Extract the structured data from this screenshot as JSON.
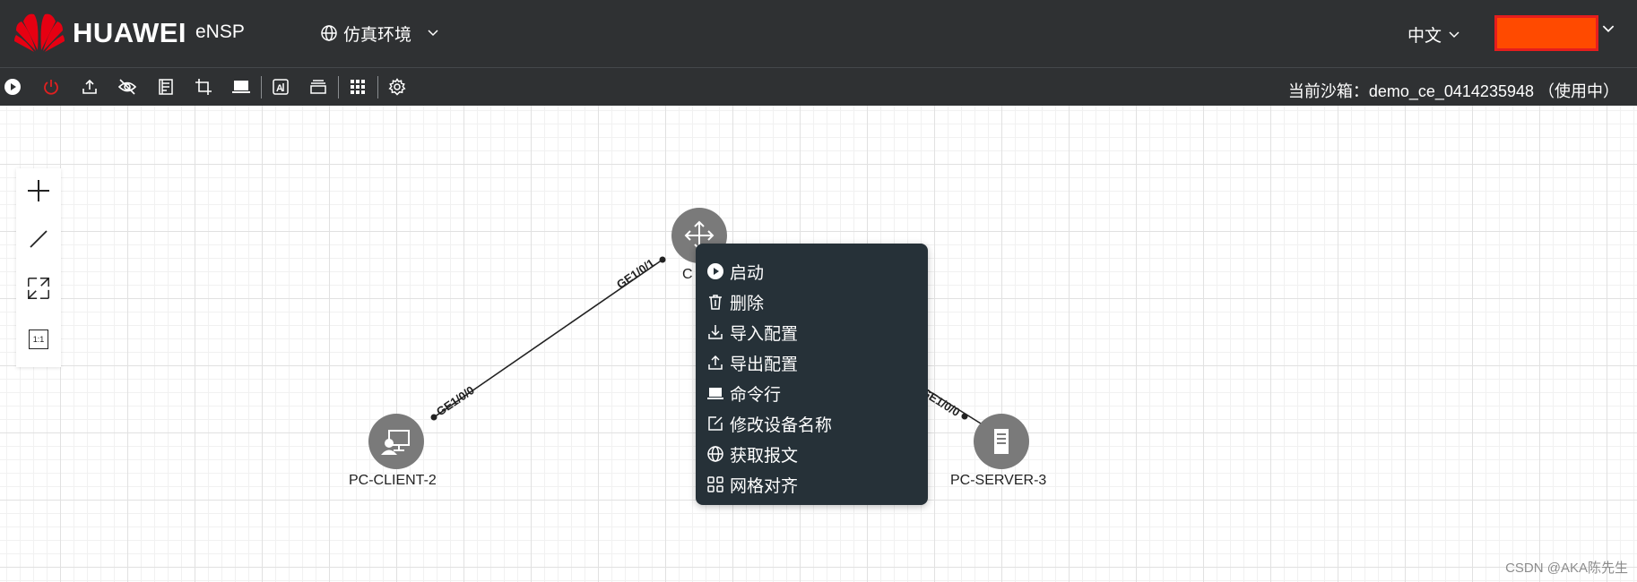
{
  "header": {
    "brand": "HUAWEI",
    "product": "eNSP",
    "environment_label": "仿真环境",
    "language": "中文",
    "icons": {
      "logo": "huawei-logo",
      "env": "globe-icon",
      "env_chevron": "chevron-down-icon",
      "lang_chevron": "chevron-down-icon",
      "user_chevron": "chevron-down-icon"
    },
    "user_box_color": "#ff4a00"
  },
  "toolbar": {
    "buttons": [
      {
        "name": "start-all",
        "icon": "play-circle-icon"
      },
      {
        "name": "stop-all",
        "icon": "power-icon",
        "color": "#e02020"
      },
      {
        "name": "upload",
        "icon": "upload-icon"
      },
      {
        "name": "hide",
        "icon": "eye-off-icon"
      },
      {
        "name": "notes",
        "icon": "document-icon"
      },
      {
        "name": "crop",
        "icon": "crop-icon"
      },
      {
        "name": "terminal",
        "icon": "laptop-icon"
      },
      {
        "name": "text",
        "icon": "text-box-icon"
      },
      {
        "name": "layers",
        "icon": "window-stack-icon"
      },
      {
        "name": "grid",
        "icon": "grid-icon"
      },
      {
        "name": "settings",
        "icon": "gear-icon"
      }
    ],
    "sandbox_text": "当前沙箱：demo_ce_0414235948 （使用中）"
  },
  "side_tools": [
    {
      "name": "add",
      "icon": "plus-icon"
    },
    {
      "name": "connect",
      "icon": "line-icon"
    },
    {
      "name": "fit",
      "icon": "expand-icon"
    },
    {
      "name": "actual-size",
      "icon": "one-to-one-icon",
      "label": "1:1"
    }
  ],
  "topology": {
    "nodes": [
      {
        "id": "ce",
        "label": "C",
        "type": "switch",
        "icon": "switch-arrows-icon"
      },
      {
        "id": "client",
        "label": "PC-CLIENT-2",
        "type": "pc-client",
        "icon": "pc-client-icon"
      },
      {
        "id": "server",
        "label": "PC-SERVER-3",
        "type": "pc-server",
        "icon": "server-icon"
      }
    ],
    "links": [
      {
        "from": "ce",
        "to": "client",
        "from_port": "GE1/0/1",
        "to_port": "GE1/0/0"
      },
      {
        "from": "ce",
        "to": "server",
        "from_port": "",
        "to_port": "GE1/0/0"
      }
    ],
    "node_color": "#7a7a7a"
  },
  "context_menu": {
    "items": [
      {
        "label": "启动",
        "icon": "play-circle-icon"
      },
      {
        "label": "删除",
        "icon": "trash-icon"
      },
      {
        "label": "导入配置",
        "icon": "download-icon"
      },
      {
        "label": "导出配置",
        "icon": "upload-icon"
      },
      {
        "label": "命令行",
        "icon": "laptop-icon"
      },
      {
        "label": "修改设备名称",
        "icon": "edit-icon"
      },
      {
        "label": "获取报文",
        "icon": "globe-icon"
      },
      {
        "label": "网格对齐",
        "icon": "grid-squares-icon"
      }
    ],
    "background": "#263138"
  },
  "watermark": "CSDN @AKA陈先生"
}
